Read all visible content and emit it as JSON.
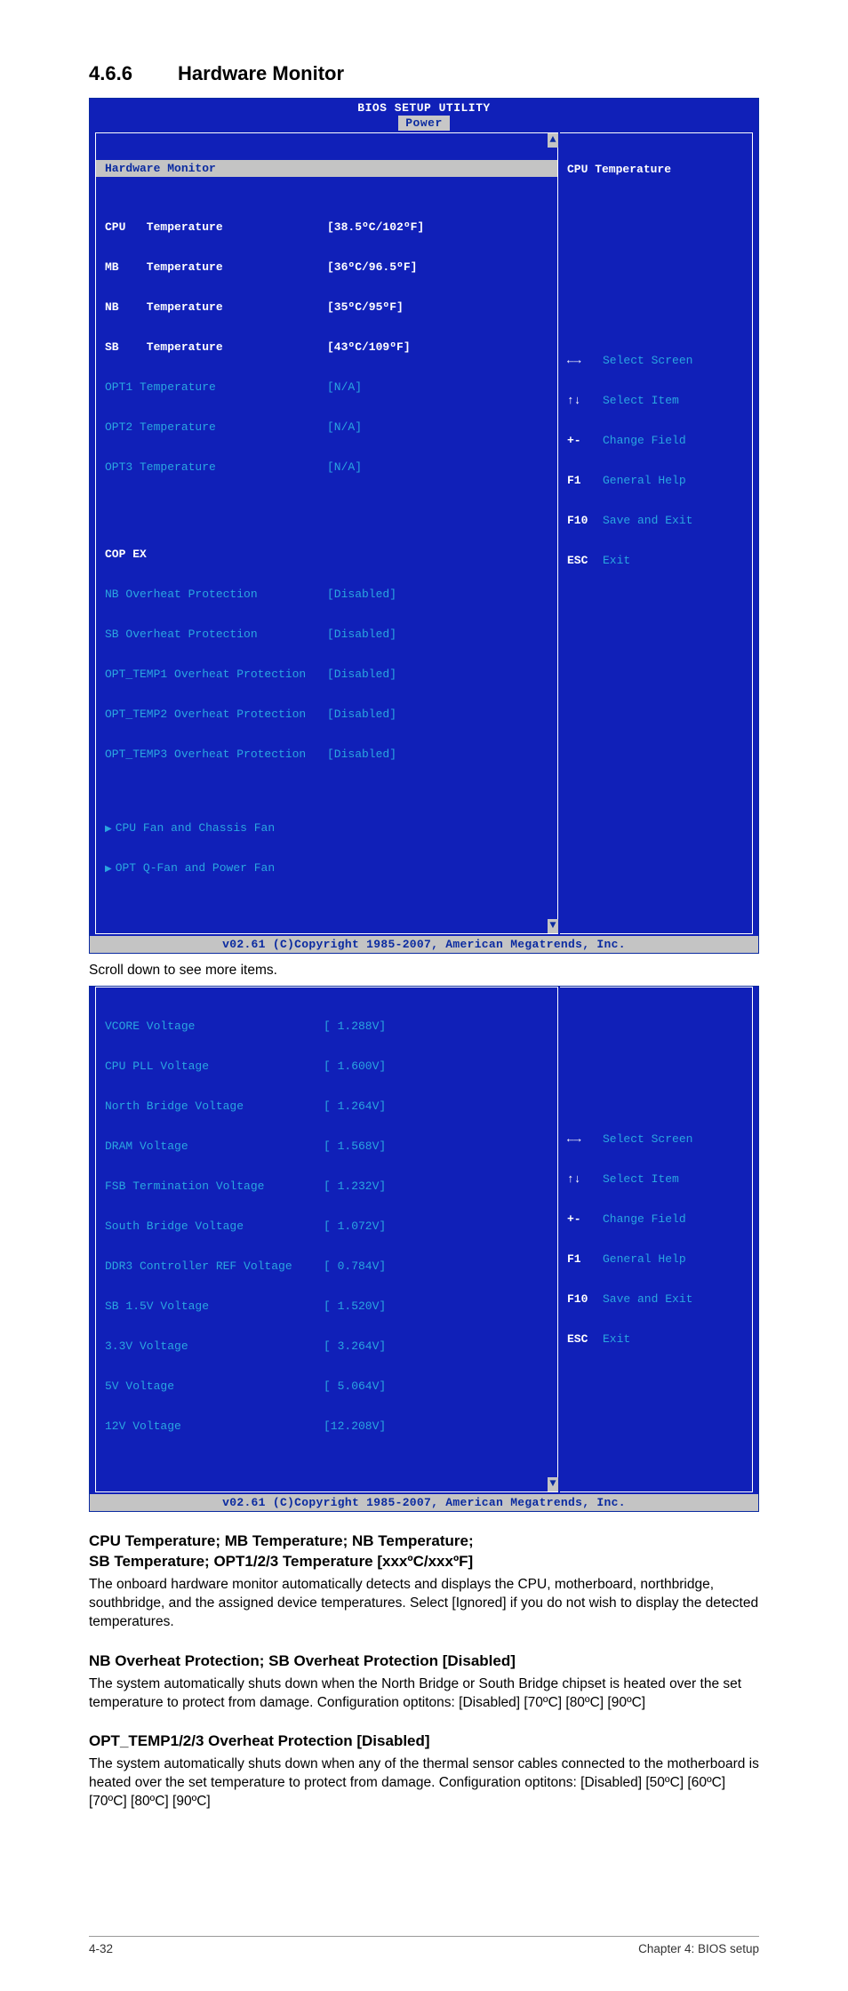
{
  "section": {
    "number": "4.6.6",
    "title": "Hardware Monitor"
  },
  "bios1": {
    "header_title": "BIOS SETUP UTILITY",
    "header_tab": "Power",
    "left_title": "Hardware Monitor",
    "rows": [
      {
        "label": "CPU   Temperature",
        "value": "[38.5ºC/102ºF]",
        "sel": true
      },
      {
        "label": "MB    Temperature",
        "value": "[36ºC/96.5ºF]",
        "sel": true
      },
      {
        "label": "NB    Temperature",
        "value": "[35ºC/95ºF]",
        "sel": true
      },
      {
        "label": "SB    Temperature",
        "value": "[43ºC/109ºF]",
        "sel": true
      },
      {
        "label": "OPT1 Temperature",
        "value": "[N/A]",
        "sel": false
      },
      {
        "label": "OPT2 Temperature",
        "value": "[N/A]",
        "sel": false
      },
      {
        "label": "OPT3 Temperature",
        "value": "[N/A]",
        "sel": false
      }
    ],
    "cop_title": "COP EX",
    "cop_rows": [
      {
        "label": "NB Overheat Protection",
        "value": "[Disabled]"
      },
      {
        "label": "SB Overheat Protection",
        "value": "[Disabled]"
      },
      {
        "label": "OPT_TEMP1 Overheat Protection",
        "value": "[Disabled]"
      },
      {
        "label": "OPT_TEMP2 Overheat Protection",
        "value": "[Disabled]"
      },
      {
        "label": "OPT_TEMP3 Overheat Protection",
        "value": "[Disabled]"
      }
    ],
    "sub_items": [
      "CPU Fan and Chassis Fan",
      "OPT Q-Fan and Power Fan"
    ],
    "right_title": "CPU Temperature",
    "nav": [
      {
        "key": "←→",
        "desc": "Select Screen"
      },
      {
        "key": "↑↓",
        "desc": "Select Item"
      },
      {
        "key": "+-",
        "desc": "Change Field"
      },
      {
        "key": "F1",
        "desc": "General Help"
      },
      {
        "key": "F10",
        "desc": "Save and Exit"
      },
      {
        "key": "ESC",
        "desc": "Exit"
      }
    ],
    "copyright": "v02.61 (C)Copyright 1985-2007, American Megatrends, Inc."
  },
  "scroll_note": "Scroll down to see more items.",
  "bios2": {
    "rows": [
      {
        "label": "VCORE Voltage",
        "value": "[ 1.288V]"
      },
      {
        "label": "CPU PLL Voltage",
        "value": "[ 1.600V]"
      },
      {
        "label": "North Bridge Voltage",
        "value": "[ 1.264V]"
      },
      {
        "label": "DRAM Voltage",
        "value": "[ 1.568V]"
      },
      {
        "label": "FSB Termination Voltage",
        "value": "[ 1.232V]"
      },
      {
        "label": "South Bridge Voltage",
        "value": "[ 1.072V]"
      },
      {
        "label": "DDR3 Controller REF Voltage",
        "value": "[ 0.784V]"
      },
      {
        "label": "SB 1.5V Voltage",
        "value": "[ 1.520V]"
      },
      {
        "label": "3.3V Voltage",
        "value": "[ 3.264V]"
      },
      {
        "label": "5V Voltage",
        "value": "[ 5.064V]"
      },
      {
        "label": "12V Voltage",
        "value": "[12.208V]"
      }
    ],
    "nav": [
      {
        "key": "←→",
        "desc": "Select Screen"
      },
      {
        "key": "↑↓",
        "desc": "Select Item"
      },
      {
        "key": "+-",
        "desc": "Change Field"
      },
      {
        "key": "F1",
        "desc": "General Help"
      },
      {
        "key": "F10",
        "desc": "Save and Exit"
      },
      {
        "key": "ESC",
        "desc": "Exit"
      }
    ],
    "copyright": "v02.61 (C)Copyright 1985-2007, American Megatrends, Inc."
  },
  "sections": {
    "s1_title_l1": "CPU Temperature; MB Temperature; NB Temperature;",
    "s1_title_l2": "SB Temperature; OPT1/2/3 Temperature [xxxºC/xxxºF]",
    "s1_body": "The onboard hardware monitor automatically detects and displays the CPU, motherboard, northbridge, southbridge, and the assigned device temperatures. Select [Ignored] if you do not wish to display the detected temperatures.",
    "s2_title": "NB Overheat Protection; SB Overheat Protection [Disabled]",
    "s2_body": "The system automatically shuts down when the North Bridge or South Bridge chipset is heated over the set temperature to protect from damage. Configuration optitons: [Disabled] [70ºC] [80ºC] [90ºC]",
    "s3_title": "OPT_TEMP1/2/3 Overheat Protection [Disabled]",
    "s3_body": "The system automatically shuts down when any of the thermal sensor cables connected to the motherboard is heated over the set temperature to protect from damage. Configuration optitons: [Disabled] [50ºC] [60ºC] [70ºC] [80ºC] [90ºC]"
  },
  "footer": {
    "left": "4-32",
    "right": "Chapter 4: BIOS setup"
  }
}
